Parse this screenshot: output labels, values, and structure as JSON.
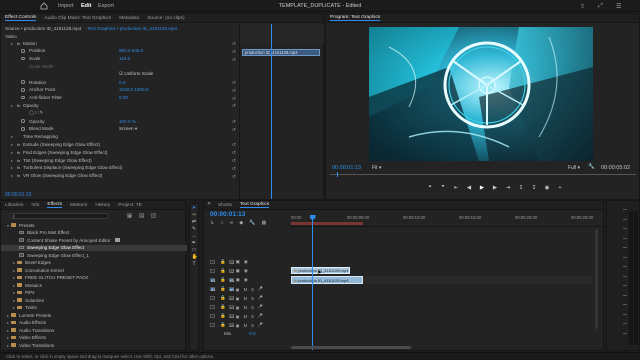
{
  "menu": {
    "items": [
      "Import",
      "Edit",
      "Export"
    ],
    "active": "Edit",
    "title": "TEMPLATE_DUPLICATE - Edited"
  },
  "top_panel_tabs": [
    "Effect Controls",
    "Audio Clip Mixer: Text Graphics",
    "Metadata",
    "Source: (no clips)"
  ],
  "effect_controls": {
    "source_line": "Source • production ID_4161128.mp4",
    "clip_line": "Text Graphics • production ID_4161128.mp4",
    "mini_clip": "production ID_4161128.mp4",
    "section_video": "Video",
    "props": [
      {
        "label": "Motion",
        "value": "",
        "indent": 1,
        "kind": "fx"
      },
      {
        "label": "Position",
        "value": "960.0    540.0",
        "indent": 2
      },
      {
        "label": "Scale",
        "value": "118.0",
        "indent": 2
      },
      {
        "label": "Scale Width",
        "value": "",
        "indent": 2,
        "dim": true
      },
      {
        "label": "",
        "value": "Uniform Scale",
        "indent": 2,
        "check": true
      },
      {
        "label": "Rotation",
        "value": "0.0",
        "indent": 2
      },
      {
        "label": "Anchor Point",
        "value": "1040.0    1080.0",
        "indent": 2
      },
      {
        "label": "Anti-flicker Filter",
        "value": "0.00",
        "indent": 2
      },
      {
        "label": "Opacity",
        "value": "",
        "indent": 1,
        "kind": "fx"
      },
      {
        "label": "",
        "value": "",
        "indent": 2,
        "shapes": true
      },
      {
        "label": "Opacity",
        "value": "100.0 %",
        "indent": 2
      },
      {
        "label": "Blend Mode",
        "value": "Screen",
        "indent": 2,
        "select": true
      },
      {
        "label": "Time Remapping",
        "value": "",
        "indent": 1
      },
      {
        "label": "Extrude (Sweeping Edge Glow Effect)",
        "value": "",
        "indent": 1,
        "kind": "fx"
      },
      {
        "label": "Find Edges (Sweeping Edge Glow Effect)",
        "value": "",
        "indent": 1,
        "kind": "fx"
      },
      {
        "label": "Tint (Sweeping Edge Glow Effect)",
        "value": "",
        "indent": 1,
        "kind": "fx"
      },
      {
        "label": "Turbulent Displace (Sweeping Edge Glow Effect)",
        "value": "",
        "indent": 1,
        "kind": "fx"
      },
      {
        "label": "VR Glow (Sweeping Edge Glow Effect)",
        "value": "",
        "indent": 1,
        "kind": "fx"
      }
    ],
    "timecode": "00:00:01:13"
  },
  "program": {
    "tab": "Program: Text Graphics",
    "timecode": "00:00:01:13",
    "fit": "Fit",
    "quality": "Full",
    "duration": "00:00:05:02"
  },
  "bottom_left_tabs": [
    "Libraries",
    "Info",
    "Effects",
    "Markers",
    "History",
    "Project: TE"
  ],
  "effects_list": [
    {
      "label": "Presets",
      "indent": 0,
      "folder": true,
      "open": true
    },
    {
      "label": "Black Pro Mist Effect",
      "indent": 1
    },
    {
      "label": "Content Shake Preset by Annoyed Editor",
      "indent": 1,
      "badge": true
    },
    {
      "label": "Sweeping Edge Glow Effect",
      "indent": 1,
      "selected": true
    },
    {
      "label": "Sweeping Edge Glow Effect_1",
      "indent": 1
    },
    {
      "label": "Bevel Edges",
      "indent": 1,
      "folder": true
    },
    {
      "label": "Convolution Kernel",
      "indent": 1,
      "folder": true
    },
    {
      "label": "FREE GLITCH PRESET PACK",
      "indent": 1,
      "folder": true
    },
    {
      "label": "Mosaics",
      "indent": 1,
      "folder": true
    },
    {
      "label": "PiPs",
      "indent": 1,
      "folder": true
    },
    {
      "label": "Solarizes",
      "indent": 1,
      "folder": true
    },
    {
      "label": "Twirls",
      "indent": 1,
      "folder": true
    },
    {
      "label": "Lumetri Presets",
      "indent": 0,
      "folder": true
    },
    {
      "label": "Audio Effects",
      "indent": 0,
      "folder": true
    },
    {
      "label": "Audio Transitions",
      "indent": 0,
      "folder": true
    },
    {
      "label": "Video Effects",
      "indent": 0,
      "folder": true
    },
    {
      "label": "Video Transitions",
      "indent": 0,
      "folder": true
    }
  ],
  "timeline": {
    "tabs": [
      "Shorts",
      "Text Graphics"
    ],
    "active_tab": "Text Graphics",
    "timecode": "00:00:01:13",
    "ruler": [
      "00:00",
      "00:00:05:00",
      "00:00:10:00",
      "00:00:15:00",
      "00:00:20:00",
      "00:00:25:00"
    ],
    "video_tracks": [
      "V3",
      "V2",
      "V1"
    ],
    "audio_tracks": [
      "A1",
      "A2",
      "A3",
      "A4",
      "A5"
    ],
    "mix_label": "Mix",
    "mix_value": "0.0",
    "clip_top": "production ID_4161128.mp4",
    "clip_bottom": "production ID_4161128.mp4"
  },
  "status_bar": "Click to select, or click in empty space and drag to marquee select. Use Shift, Opt, and Cmd for other options.",
  "colors": {
    "accent": "#2d8ceb",
    "clip_top": "#a9c4d8",
    "clip_bottom": "#93b7d6",
    "folder": "#b88d52",
    "playhead": "#2d8ceb"
  }
}
